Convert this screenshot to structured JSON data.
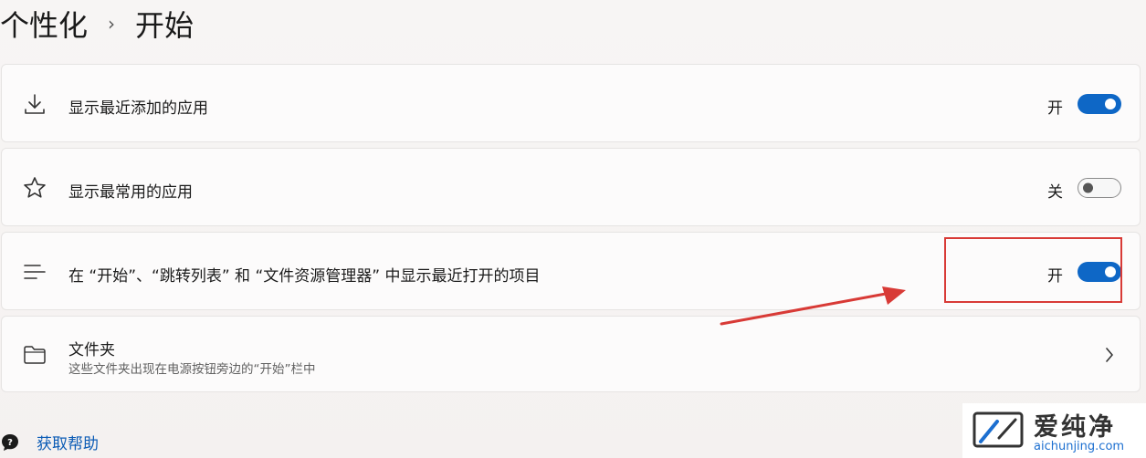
{
  "breadcrumb": {
    "parent": "个性化",
    "separator": "›",
    "current": "开始"
  },
  "settings": [
    {
      "icon": "download-icon",
      "label": "显示最近添加的应用",
      "state_label": "开",
      "toggle_on": true
    },
    {
      "icon": "star-icon",
      "label": "显示最常用的应用",
      "state_label": "关",
      "toggle_on": false
    },
    {
      "icon": "list-lines-icon",
      "label": "在 “开始”、“跳转列表” 和 “文件资源管理器” 中显示最近打开的项目",
      "state_label": "开",
      "toggle_on": true
    }
  ],
  "folders": {
    "icon": "folder-icon",
    "title": "文件夹",
    "description": "这些文件夹出现在电源按钮旁边的“开始”栏中"
  },
  "help": {
    "label": "获取帮助"
  },
  "watermark": {
    "title": "爱纯净",
    "url": "aichunjing.com"
  },
  "colors": {
    "accent": "#0e67c6",
    "annotation": "#d83a36",
    "link": "#0a5bb5"
  }
}
